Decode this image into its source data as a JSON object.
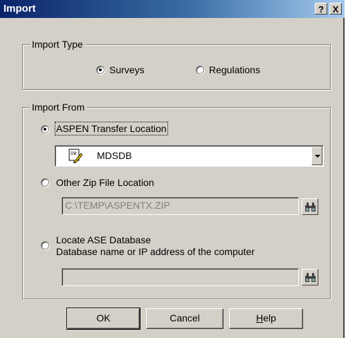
{
  "window": {
    "title": "Import",
    "help_glyph": "?",
    "close_glyph": "X"
  },
  "import_type": {
    "legend": "Import Type",
    "options": [
      {
        "label": "Surveys",
        "checked": true
      },
      {
        "label": "Regulations",
        "checked": false
      }
    ]
  },
  "import_from": {
    "legend": "Import From",
    "aspen": {
      "label": "ASPEN Transfer Location",
      "checked": true,
      "selected_value": "MDSDB",
      "icon": "database-pencil-icon"
    },
    "zip": {
      "label": "Other Zip File Location",
      "checked": false,
      "path": "C:\\TEMP\\ASPENTX.ZIP",
      "browse_icon": "binoculars-icon"
    },
    "ase": {
      "label_line1": "Locate ASE Database",
      "label_line2": "Database name or IP address of the computer",
      "checked": false,
      "value": "",
      "browse_icon": "binoculars-icon"
    }
  },
  "buttons": {
    "ok": "OK",
    "cancel": "Cancel",
    "help": "Help"
  },
  "colors": {
    "face": "#d4d0c8",
    "title_start": "#0a246a",
    "title_end": "#a6caf0"
  }
}
